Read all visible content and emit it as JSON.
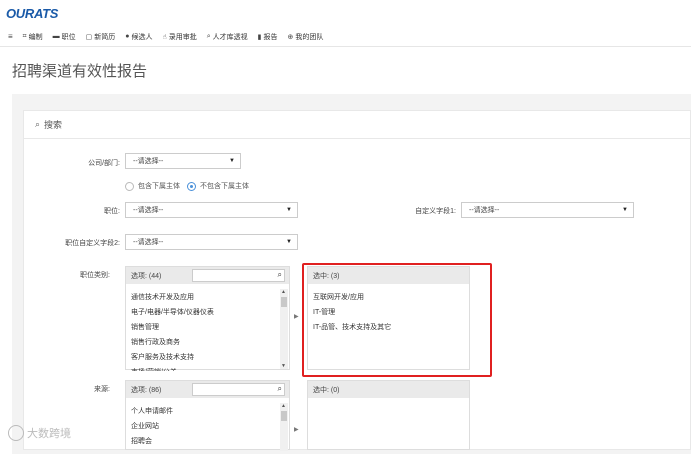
{
  "logo": {
    "text_a": "OUR",
    "text_b": "ATS"
  },
  "nav": {
    "menu_icon": "hamburger-icon",
    "items": [
      {
        "icon": "org-chart-icon",
        "label": "编制"
      },
      {
        "icon": "briefcase-icon",
        "label": "职位"
      },
      {
        "icon": "document-icon",
        "label": "新简历"
      },
      {
        "icon": "user-icon",
        "label": "候选人"
      },
      {
        "icon": "hand-icon",
        "label": "录用审批"
      },
      {
        "icon": "search-icon",
        "label": "人才库透视"
      },
      {
        "icon": "bar-chart-icon",
        "label": "报告"
      },
      {
        "icon": "team-icon",
        "label": "我的团队"
      }
    ]
  },
  "page": {
    "title": "招聘渠道有效性报告"
  },
  "search": {
    "title": "搜索"
  },
  "form": {
    "company_label": "公司/部门:",
    "company_value": "--请选择--",
    "radio_include": "包含下属主体",
    "radio_exclude": "不包含下属主体",
    "position_label": "职位:",
    "position_value": "--请选择--",
    "custom1_label": "自定义字段1:",
    "custom1_value": "--请选择--",
    "custom2_label": "职位自定义字段2:",
    "custom2_value": "--请选择--",
    "category_label": "职位类别:",
    "source_label": "来源:"
  },
  "category": {
    "options_header": "选项: (44)",
    "selected_header": "选中: (3)",
    "options": [
      "通信技术开发及应用",
      "电子/电器/半导体/仪器仪表",
      "销售管理",
      "销售行政及商务",
      "客户服务及技术支持",
      "市场/营销/公关"
    ],
    "selected": [
      "互联网开发/应用",
      "IT-管理",
      "IT-品管、技术支持及其它"
    ]
  },
  "source": {
    "options_header": "选项: (86)",
    "selected_header": "选中: (0)",
    "options": [
      "个人申请邮件",
      "企业网站",
      "招聘会"
    ]
  },
  "watermark": {
    "text": "大数跨境"
  }
}
